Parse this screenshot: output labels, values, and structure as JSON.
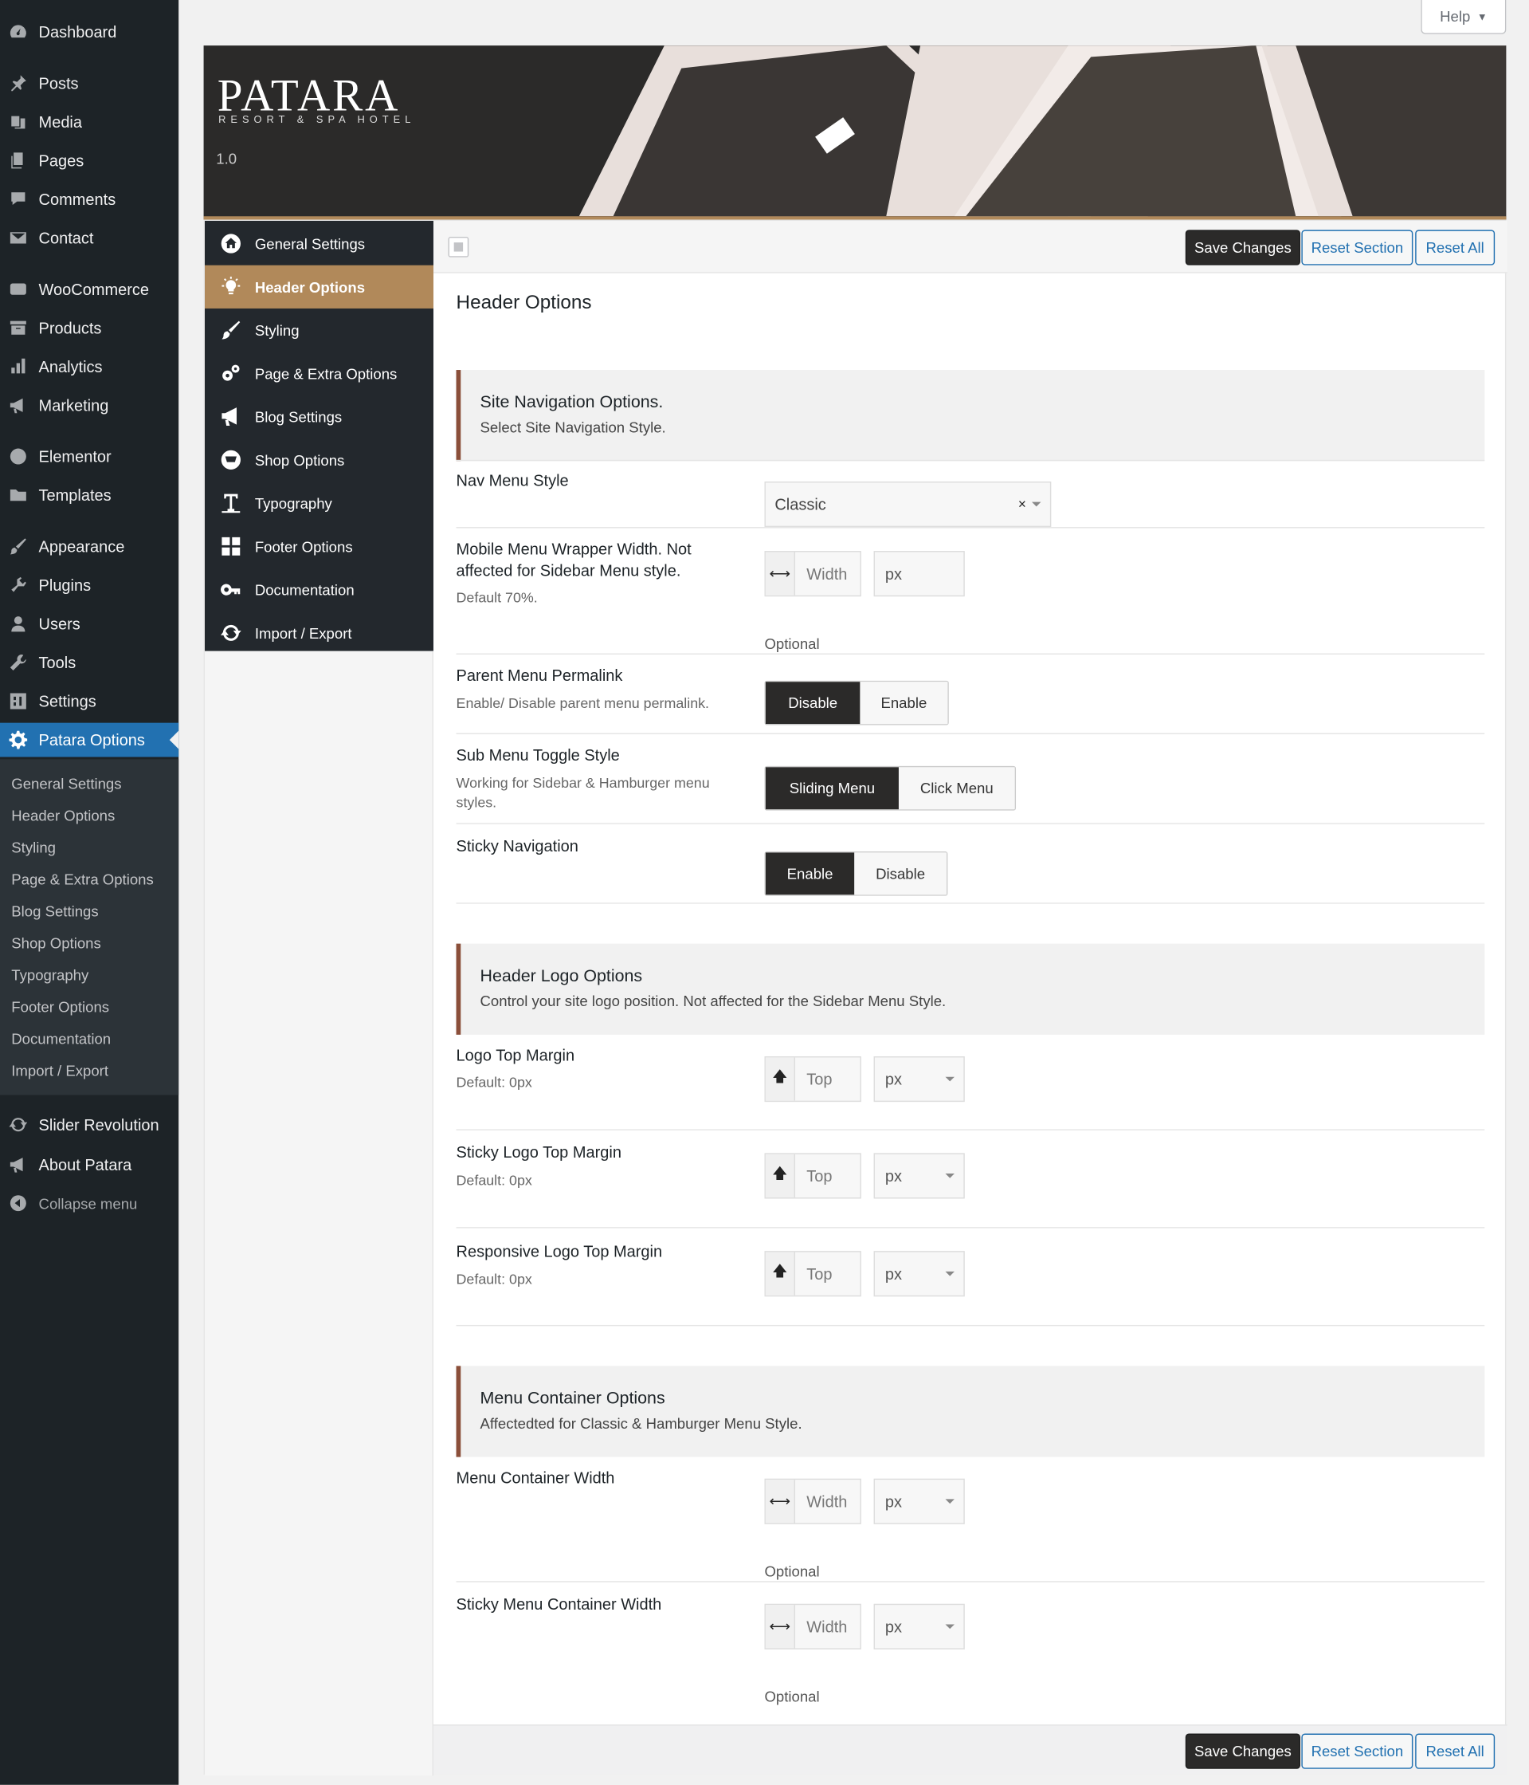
{
  "wp_menu": {
    "items": [
      {
        "label": "Dashboard",
        "icon": "dashboard-icon"
      },
      {
        "label": "Posts",
        "icon": "pin-icon"
      },
      {
        "label": "Media",
        "icon": "media-icon"
      },
      {
        "label": "Pages",
        "icon": "pages-icon"
      },
      {
        "label": "Comments",
        "icon": "comments-icon"
      },
      {
        "label": "Contact",
        "icon": "mail-icon"
      },
      {
        "label": "WooCommerce",
        "icon": "woo-icon"
      },
      {
        "label": "Products",
        "icon": "archive-icon"
      },
      {
        "label": "Analytics",
        "icon": "bar-chart-icon"
      },
      {
        "label": "Marketing",
        "icon": "megaphone-icon"
      },
      {
        "label": "Elementor",
        "icon": "elementor-icon"
      },
      {
        "label": "Templates",
        "icon": "folder-icon"
      },
      {
        "label": "Appearance",
        "icon": "brush-icon"
      },
      {
        "label": "Plugins",
        "icon": "plugin-icon"
      },
      {
        "label": "Users",
        "icon": "user-icon"
      },
      {
        "label": "Tools",
        "icon": "wrench-icon"
      },
      {
        "label": "Settings",
        "icon": "settings-icon"
      },
      {
        "label": "Patara Options",
        "icon": "gear-icon"
      },
      {
        "label": "Slider Revolution",
        "icon": "refresh-icon"
      },
      {
        "label": "About Patara",
        "icon": "megaphone-icon"
      },
      {
        "label": "Collapse menu",
        "icon": "collapse-icon"
      }
    ],
    "submenu": [
      "General Settings",
      "Header Options",
      "Styling",
      "Page & Extra Options",
      "Blog Settings",
      "Shop Options",
      "Typography",
      "Footer Options",
      "Documentation",
      "Import / Export"
    ]
  },
  "help_label": "Help",
  "banner": {
    "brand": "PATARA",
    "tagline": "RESORT & SPA HOTEL",
    "version": "1.0"
  },
  "options_nav": [
    {
      "label": "General Settings",
      "icon": "home-icon"
    },
    {
      "label": "Header Options",
      "icon": "lightbulb-icon"
    },
    {
      "label": "Styling",
      "icon": "brush-icon"
    },
    {
      "label": "Page & Extra Options",
      "icon": "cogs-icon"
    },
    {
      "label": "Blog Settings",
      "icon": "megaphone-icon"
    },
    {
      "label": "Shop Options",
      "icon": "cart-icon"
    },
    {
      "label": "Typography",
      "icon": "text-icon"
    },
    {
      "label": "Footer Options",
      "icon": "grid-icon"
    },
    {
      "label": "Documentation",
      "icon": "key-icon"
    },
    {
      "label": "Import / Export",
      "icon": "refresh-icon"
    }
  ],
  "actions": {
    "save": "Save Changes",
    "reset_section": "Reset Section",
    "reset_all": "Reset All"
  },
  "page_title": "Header Options",
  "sections": {
    "nav": {
      "title": "Site Navigation Options.",
      "desc": "Select Site Navigation Style."
    },
    "logo": {
      "title": "Header Logo Options",
      "desc": "Control your site logo position. Not affected for the Sidebar Menu Style."
    },
    "container": {
      "title": "Menu Container Options",
      "desc": "Affectedted for Classic & Hamburger Menu Style."
    }
  },
  "fields": {
    "nav_style": {
      "label": "Nav Menu Style",
      "value": "Classic",
      "clear": "×"
    },
    "mobile_width": {
      "label": "Mobile Menu Wrapper Width. Not affected for Sidebar Menu style.",
      "desc": "Default 70%.",
      "placeholder": "Width",
      "unit": "px",
      "optional": "Optional"
    },
    "parent_permalink": {
      "label": "Parent Menu Permalink",
      "desc": "Enable/ Disable parent menu permalink.",
      "on": "Disable",
      "off": "Enable"
    },
    "submenu_toggle": {
      "label": "Sub Menu Toggle Style",
      "desc": "Working for Sidebar & Hamburger menu styles.",
      "on": "Sliding Menu",
      "off": "Click Menu"
    },
    "sticky_nav": {
      "label": "Sticky Navigation",
      "on": "Enable",
      "off": "Disable"
    },
    "logo_top": {
      "label": "Logo Top Margin",
      "desc": "Default: 0px",
      "placeholder": "Top",
      "unit": "px"
    },
    "sticky_logo_top": {
      "label": "Sticky Logo Top Margin",
      "desc": "Default: 0px",
      "placeholder": "Top",
      "unit": "px"
    },
    "resp_logo_top": {
      "label": "Responsive Logo Top Margin",
      "desc": "Default: 0px",
      "placeholder": "Top",
      "unit": "px"
    },
    "container_width": {
      "label": "Menu Container Width",
      "placeholder": "Width",
      "unit": "px",
      "optional": "Optional"
    },
    "sticky_container_width": {
      "label": "Sticky Menu Container Width",
      "placeholder": "Width",
      "unit": "px",
      "optional": "Optional"
    }
  },
  "colors": {
    "accent": "#b1895a",
    "wp_blue": "#2271b1",
    "sidebar": "#1d2327",
    "dark": "#2b2a29"
  }
}
